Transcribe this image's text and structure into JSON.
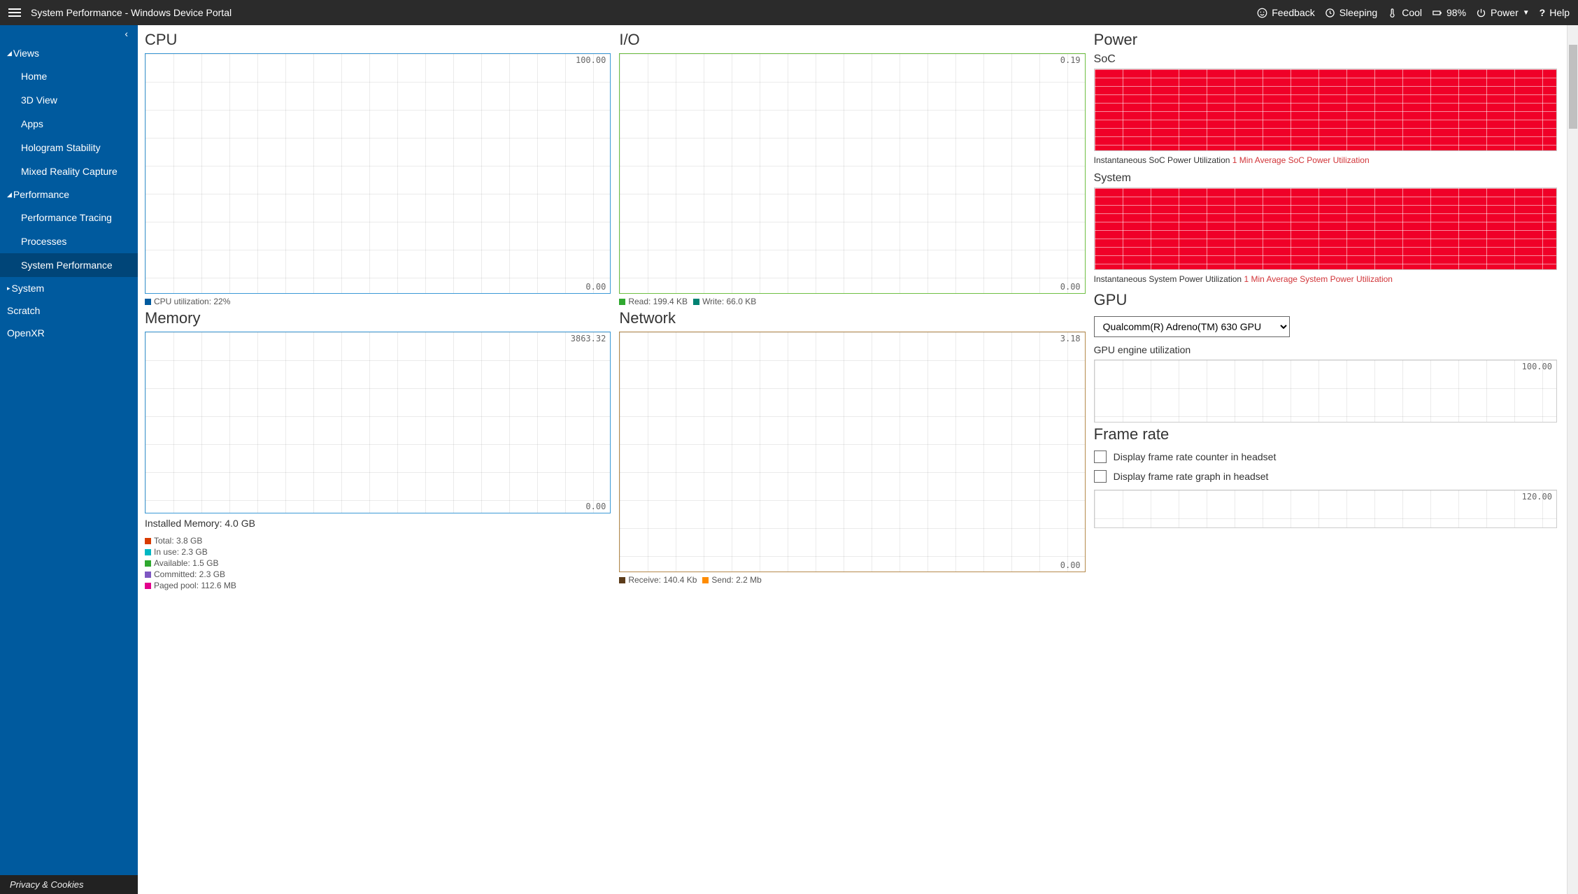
{
  "header": {
    "title": "System Performance - Windows Device Portal",
    "feedback": "Feedback",
    "sleeping": "Sleeping",
    "cool": "Cool",
    "battery": "98%",
    "power": "Power",
    "help": "Help"
  },
  "sidebar": {
    "sections": {
      "views": "Views",
      "performance": "Performance",
      "system": "System"
    },
    "views_items": [
      "Home",
      "3D View",
      "Apps",
      "Hologram Stability",
      "Mixed Reality Capture"
    ],
    "perf_items": [
      "Performance Tracing",
      "Processes",
      "System Performance"
    ],
    "top_items": [
      "Scratch",
      "OpenXR"
    ],
    "footer": "Privacy & Cookies"
  },
  "panels": {
    "cpu": {
      "title": "CPU",
      "max": "100.00",
      "min": "0.00",
      "legend_util": "CPU utilization: 22%"
    },
    "memory": {
      "title": "Memory",
      "max": "3863.32",
      "min": "0.00",
      "installed": "Installed Memory: 4.0 GB",
      "legend": [
        {
          "color": "sw-red",
          "text": "Total: 3.8 GB"
        },
        {
          "color": "sw-cyan",
          "text": "In use: 2.3 GB"
        },
        {
          "color": "sw-green",
          "text": "Available: 1.5 GB"
        },
        {
          "color": "sw-purple",
          "text": "Committed: 2.3 GB"
        },
        {
          "color": "sw-magenta",
          "text": "Paged pool: 112.6 MB"
        }
      ]
    },
    "io": {
      "title": "I/O",
      "max": "0.19",
      "min": "0.00",
      "read": "Read: 199.4 KB",
      "write": "Write: 66.0 KB"
    },
    "network": {
      "title": "Network",
      "max": "3.18",
      "min": "0.00",
      "recv": "Receive: 140.4 Kb",
      "send": "Send: 2.2 Mb"
    },
    "power": {
      "title": "Power",
      "soc_label": "SoC",
      "soc_legend_inst": "Instantaneous SoC Power Utilization",
      "soc_legend_avg": "1 Min Average SoC Power Utilization",
      "sys_label": "System",
      "sys_legend_inst": "Instantaneous System Power Utilization",
      "sys_legend_avg": "1 Min Average System Power Utilization"
    },
    "gpu": {
      "title": "GPU",
      "selected": "Qualcomm(R) Adreno(TM) 630 GPU",
      "util_label": "GPU engine utilization",
      "max": "100.00"
    },
    "frame": {
      "title": "Frame rate",
      "cb_counter": "Display frame rate counter in headset",
      "cb_graph": "Display frame rate graph in headset",
      "max": "120.00"
    }
  },
  "chart_data": [
    {
      "type": "line",
      "title": "CPU",
      "ylim": [
        0,
        100
      ],
      "series": [
        {
          "name": "CPU utilization",
          "latest": 22
        }
      ]
    },
    {
      "type": "line",
      "title": "I/O",
      "ylim": [
        0,
        0.19
      ],
      "series": [
        {
          "name": "Read",
          "latest_text": "199.4 KB"
        },
        {
          "name": "Write",
          "latest_text": "66.0 KB"
        }
      ]
    },
    {
      "type": "line",
      "title": "Memory",
      "ylim": [
        0,
        3863.32
      ],
      "series": [
        {
          "name": "Total",
          "value": 3.8,
          "unit": "GB"
        },
        {
          "name": "In use",
          "value": 2.3,
          "unit": "GB"
        },
        {
          "name": "Available",
          "value": 1.5,
          "unit": "GB"
        },
        {
          "name": "Committed",
          "value": 2.3,
          "unit": "GB"
        },
        {
          "name": "Paged pool",
          "value": 112.6,
          "unit": "MB"
        }
      ]
    },
    {
      "type": "line",
      "title": "Network",
      "ylim": [
        0,
        3.18
      ],
      "series": [
        {
          "name": "Receive",
          "latest_text": "140.4 Kb"
        },
        {
          "name": "Send",
          "latest_text": "2.2 Mb"
        }
      ]
    },
    {
      "type": "area",
      "title": "SoC Power",
      "series": [
        {
          "name": "Instantaneous"
        },
        {
          "name": "1 Min Avg"
        }
      ]
    },
    {
      "type": "area",
      "title": "System Power",
      "series": [
        {
          "name": "Instantaneous"
        },
        {
          "name": "1 Min Avg"
        }
      ]
    },
    {
      "type": "line",
      "title": "GPU engine utilization",
      "ylim": [
        0,
        100
      ]
    },
    {
      "type": "line",
      "title": "Frame rate",
      "ylim": [
        0,
        120
      ]
    }
  ]
}
